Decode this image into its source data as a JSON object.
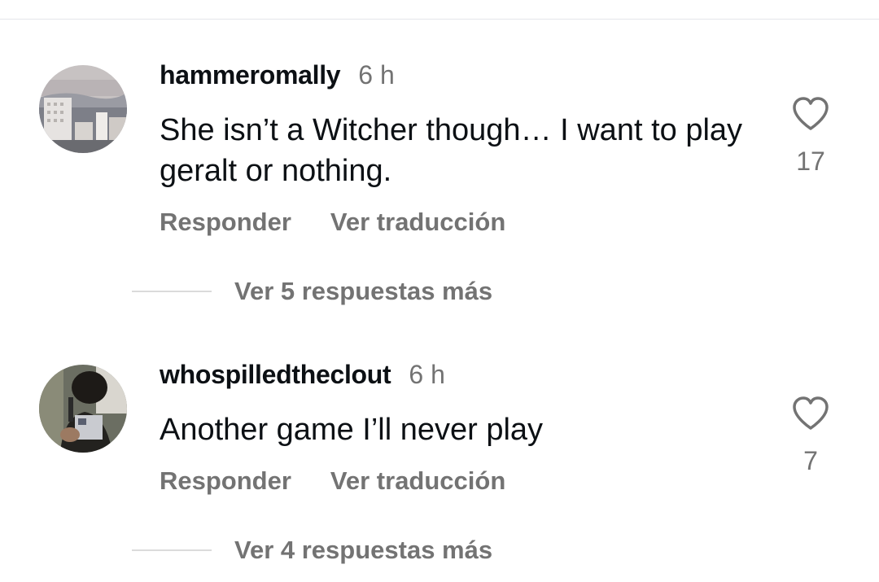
{
  "comments": [
    {
      "username": "hammeromally",
      "time": "6 h",
      "text": "She isn’t a Witcher though… I want to play geralt or nothing.",
      "like_count": "17",
      "reply_label": "Responder",
      "translate_label": "Ver traducción",
      "view_replies_label": "Ver 5 respuestas más",
      "avatar_icon": "city-skyline-avatar"
    },
    {
      "username": "whospilledtheclout",
      "time": "6 h",
      "text": "Another game I’ll never play",
      "like_count": "7",
      "reply_label": "Responder",
      "translate_label": "Ver traducción",
      "view_replies_label": "Ver 4 respuestas más",
      "avatar_icon": "person-photo-avatar"
    }
  ],
  "colors": {
    "primary_text": "#0c1014",
    "secondary_text": "#737373",
    "divider": "#dbdbdb"
  }
}
